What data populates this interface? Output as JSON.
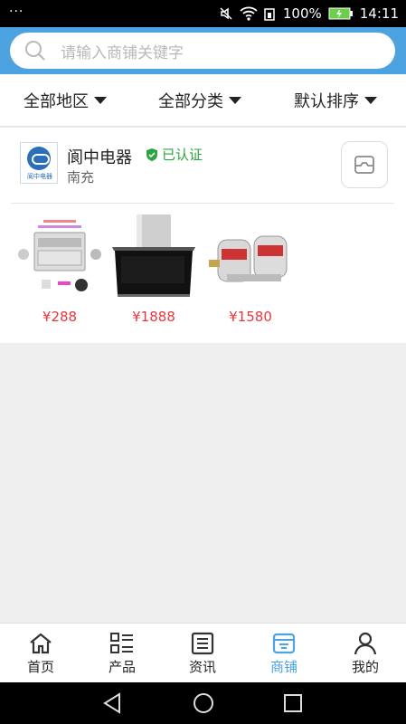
{
  "status_bar": {
    "battery": "100%",
    "time": "14:11",
    "dots": "···"
  },
  "search": {
    "placeholder": "请输入商铺关键字"
  },
  "filters": [
    {
      "label": "全部地区"
    },
    {
      "label": "全部分类"
    },
    {
      "label": "默认排序"
    }
  ],
  "shop": {
    "name": "阆中电器",
    "verified_label": "已认证",
    "city": "南充",
    "logo_text": "阆中电器",
    "products": [
      {
        "price": "¥288",
        "image": "dishwasher-combo"
      },
      {
        "price": "¥1888",
        "image": "range-hood"
      },
      {
        "price": "¥1580",
        "image": "water-purifier"
      }
    ]
  },
  "bottom_nav": [
    {
      "label": "首页",
      "icon": "home-icon"
    },
    {
      "label": "产品",
      "icon": "product-list-icon"
    },
    {
      "label": "资讯",
      "icon": "news-icon"
    },
    {
      "label": "商铺",
      "icon": "shop-icon",
      "active": true
    },
    {
      "label": "我的",
      "icon": "user-icon"
    }
  ],
  "colors": {
    "accent": "#4ca3df",
    "price": "#e8383d",
    "verified": "#2aa53f"
  }
}
